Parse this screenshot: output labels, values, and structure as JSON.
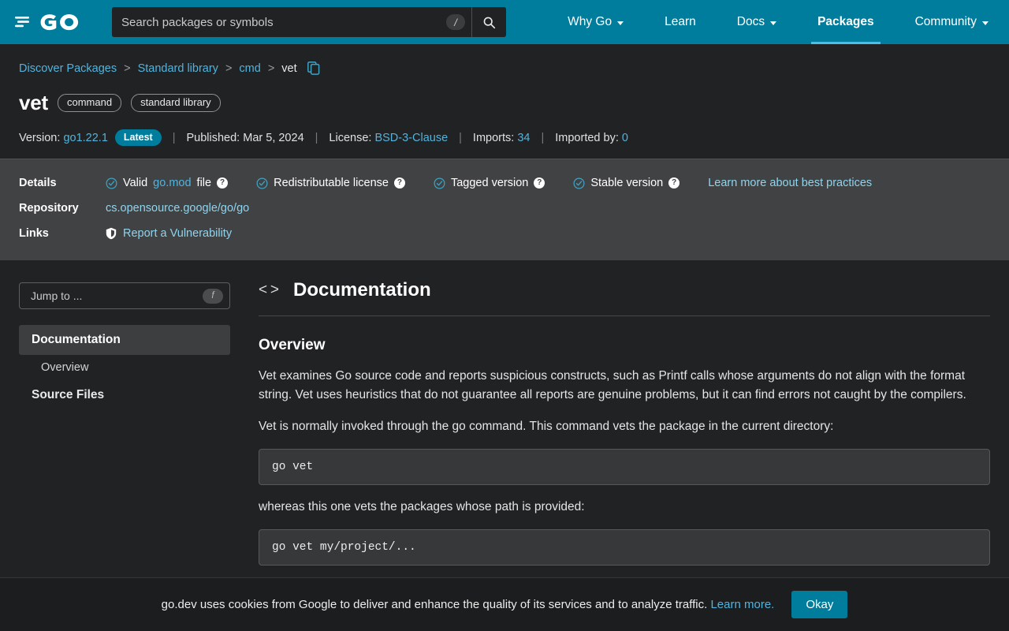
{
  "header": {
    "logo_alt": "Go",
    "search": {
      "placeholder": "Search packages or symbols",
      "value": "",
      "shortcut": "/",
      "search_icon": "search-icon"
    },
    "nav": [
      {
        "label": "Why Go",
        "has_caret": true,
        "active": false
      },
      {
        "label": "Learn",
        "has_caret": false,
        "active": false
      },
      {
        "label": "Docs",
        "has_caret": true,
        "active": false
      },
      {
        "label": "Packages",
        "has_caret": false,
        "active": true
      },
      {
        "label": "Community",
        "has_caret": true,
        "active": false
      }
    ],
    "accent_color": "#007d9c",
    "underline_color": "#4fbce8"
  },
  "breadcrumb": {
    "items": [
      {
        "label": "Discover Packages",
        "link": true
      },
      {
        "label": "Standard library",
        "link": true
      },
      {
        "label": "cmd",
        "link": true
      },
      {
        "label": "vet",
        "link": false
      }
    ],
    "separator": ">",
    "copy_icon": "copy-path-icon"
  },
  "package": {
    "name": "vet",
    "chips": [
      "command",
      "standard library"
    ],
    "meta": {
      "version_label": "Version:",
      "version_value": "go1.22.1",
      "latest_badge": "Latest",
      "published_label": "Published:",
      "published_value": "Mar 5, 2024",
      "license_label": "License:",
      "license_value": "BSD-3-Clause",
      "imports_label": "Imports:",
      "imports_value": "34",
      "imported_by_label": "Imported by:",
      "imported_by_value": "0",
      "separator": "|"
    }
  },
  "details": {
    "details_label": "Details",
    "checks": [
      {
        "prefix": "Valid ",
        "link": "go.mod",
        "suffix": " file",
        "help": "?"
      },
      {
        "prefix": "Redistributable license",
        "link": "",
        "suffix": "",
        "help": "?"
      },
      {
        "prefix": "Tagged version",
        "link": "",
        "suffix": "",
        "help": "?"
      },
      {
        "prefix": "Stable version",
        "link": "",
        "suffix": "",
        "help": "?"
      }
    ],
    "best_practices_link": "Learn more about best practices",
    "repository_label": "Repository",
    "repository_value": "cs.opensource.google/go/go",
    "links_label": "Links",
    "vulnerability_link": "Report a Vulnerability",
    "shield_icon": "shield-icon",
    "band_color": "#414244",
    "check_color": "#3fa3c4"
  },
  "sidebar": {
    "jump_to_placeholder": "Jump to ...",
    "jump_to_shortcut": "f",
    "items": [
      {
        "label": "Documentation",
        "type": "section",
        "selected": true
      },
      {
        "label": "Overview",
        "type": "sub",
        "selected": false
      },
      {
        "label": "Source Files",
        "type": "section",
        "selected": false
      }
    ]
  },
  "main": {
    "doc_icon": "code-brackets-icon",
    "doc_title": "Documentation",
    "overview_title": "Overview",
    "paragraphs": [
      "Vet examines Go source code and reports suspicious constructs, such as Printf calls whose arguments do not align with the format string. Vet uses heuristics that do not guarantee all reports are genuine problems, but it can find errors not caught by the compilers.",
      "Vet is normally invoked through the go command. This command vets the package in the current directory:"
    ],
    "code_1": "go vet",
    "paragraph_2": "whereas this one vets the packages whose path is provided:",
    "code_2": "go vet my/project/..."
  },
  "cookie_banner": {
    "text": "go.dev uses cookies from Google to deliver and enhance the quality of its services and to analyze traffic.",
    "learn_more": "Learn more.",
    "okay_button": "Okay"
  }
}
